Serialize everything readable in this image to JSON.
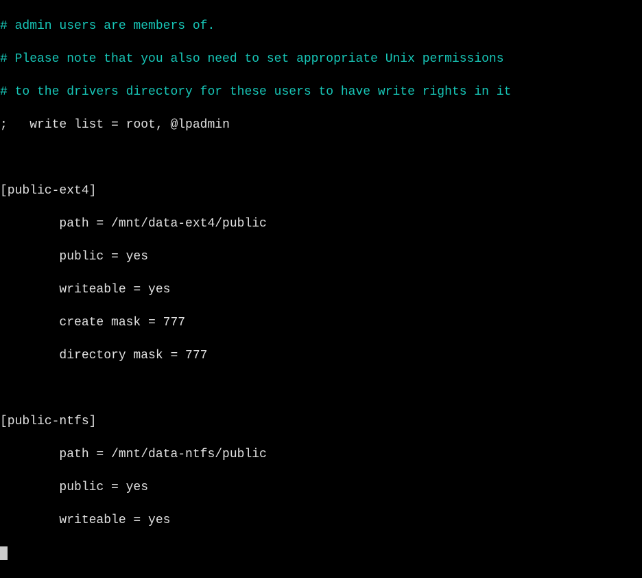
{
  "lines": {
    "c1": "# admin users are members of.",
    "c2": "# Please note that you also need to set appropriate Unix permissions",
    "c3": "# to the drivers directory for these users to have write rights in it",
    "l4_pre": ";",
    "l4_rest": "   write list = root, @lpadmin",
    "l5": "",
    "l6": "[public-ext4]",
    "l7": "        path = /mnt/data-ext4/public",
    "l8": "        public = yes",
    "l9": "        writeable = yes",
    "l10": "        create mask = 777",
    "l11": "        directory mask = 777",
    "l12": "",
    "l13": "[public-ntfs]",
    "l14": "        path = /mnt/data-ntfs/public",
    "l15": "        public = yes",
    "l16": "        writeable = yes"
  }
}
